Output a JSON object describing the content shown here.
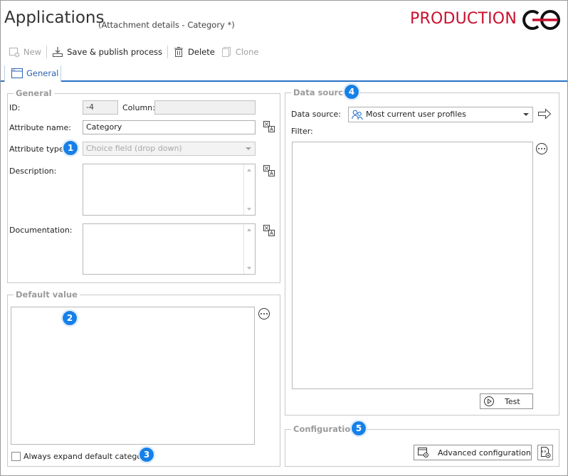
{
  "header": {
    "title": "Applications",
    "subtitle": "(Attachment details - Category *)",
    "environment": "PRODUCTION"
  },
  "toolbar": {
    "new_label": "New",
    "save_publish_label": "Save & publish process",
    "delete_label": "Delete",
    "clone_label": "Clone"
  },
  "tabs": [
    {
      "label": "General",
      "active": true
    }
  ],
  "general": {
    "legend": "General",
    "id_label": "ID:",
    "id_value": "-4",
    "column_label": "Column:",
    "column_value": "",
    "attribute_name_label": "Attribute name:",
    "attribute_name_value": "Category",
    "attribute_type_label": "Attribute type:",
    "attribute_type_value": "Choice field (drop down)",
    "description_label": "Description:",
    "documentation_label": "Documentation:"
  },
  "default_value": {
    "legend": "Default value",
    "always_expand_label": "Always expand default category",
    "always_expand_checked": false
  },
  "data_source": {
    "legend": "Data source",
    "data_source_label": "Data source:",
    "data_source_value": "Most current user profiles",
    "filter_label": "Filter:",
    "test_label": "Test"
  },
  "configuration": {
    "legend": "Configuration",
    "advanced_label": "Advanced configuration"
  },
  "badges": [
    "1",
    "2",
    "3",
    "4",
    "5"
  ],
  "colors": {
    "accent": "#2b73c6",
    "environment": "#c8102e",
    "badge": "#1680e8",
    "legend_text": "#9b9b9b"
  }
}
